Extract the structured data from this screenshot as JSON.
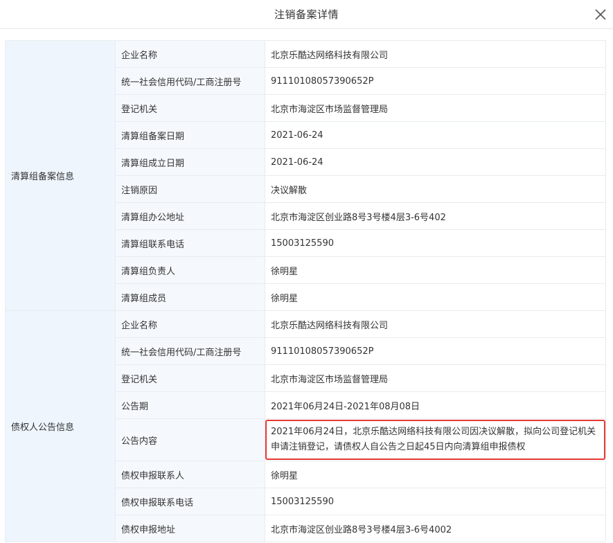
{
  "header": {
    "title": "注销备案详情",
    "close_icon": "close-icon"
  },
  "sections": [
    {
      "group": "清算组备案信息",
      "rows": [
        {
          "label": "企业名称",
          "value": "北京乐酷达网络科技有限公司"
        },
        {
          "label": "统一社会信用代码/工商注册号",
          "value": "91110108057390652P"
        },
        {
          "label": "登记机关",
          "value": "北京市海淀区市场监督管理局"
        },
        {
          "label": "清算组备案日期",
          "value": "2021-06-24"
        },
        {
          "label": "清算组成立日期",
          "value": "2021-06-24"
        },
        {
          "label": "注销原因",
          "value": "决议解散"
        },
        {
          "label": "清算组办公地址",
          "value": "北京市海淀区创业路8号3号楼4层3-6号402"
        },
        {
          "label": "清算组联系电话",
          "value": "15003125590"
        },
        {
          "label": "清算组负责人",
          "value": "徐明星"
        },
        {
          "label": "清算组成员",
          "value": "徐明星"
        }
      ]
    },
    {
      "group": "债权人公告信息",
      "rows": [
        {
          "label": "企业名称",
          "value": "北京乐酷达网络科技有限公司"
        },
        {
          "label": "统一社会信用代码/工商注册号",
          "value": "91110108057390652P"
        },
        {
          "label": "登记机关",
          "value": "北京市海淀区市场监督管理局"
        },
        {
          "label": "公告期",
          "value": "2021年06月24日-2021年08月08日"
        },
        {
          "label": "公告内容",
          "value": "2021年06月24日，北京乐酷达网络科技有限公司因决议解散，拟向公司登记机关申请注销登记，请债权人自公告之日起45日内向清算组申报债权"
        },
        {
          "label": "债权申报联系人",
          "value": "徐明星"
        },
        {
          "label": "债权申报联系电话",
          "value": "15003125590"
        },
        {
          "label": "债权申报地址",
          "value": "北京市海淀区创业路8号3号楼4层3-6号4002"
        }
      ]
    }
  ],
  "colors": {
    "highlight_border": "#e53935",
    "group_bg": "#eef5fd",
    "label_bg": "#f5f9fd"
  }
}
